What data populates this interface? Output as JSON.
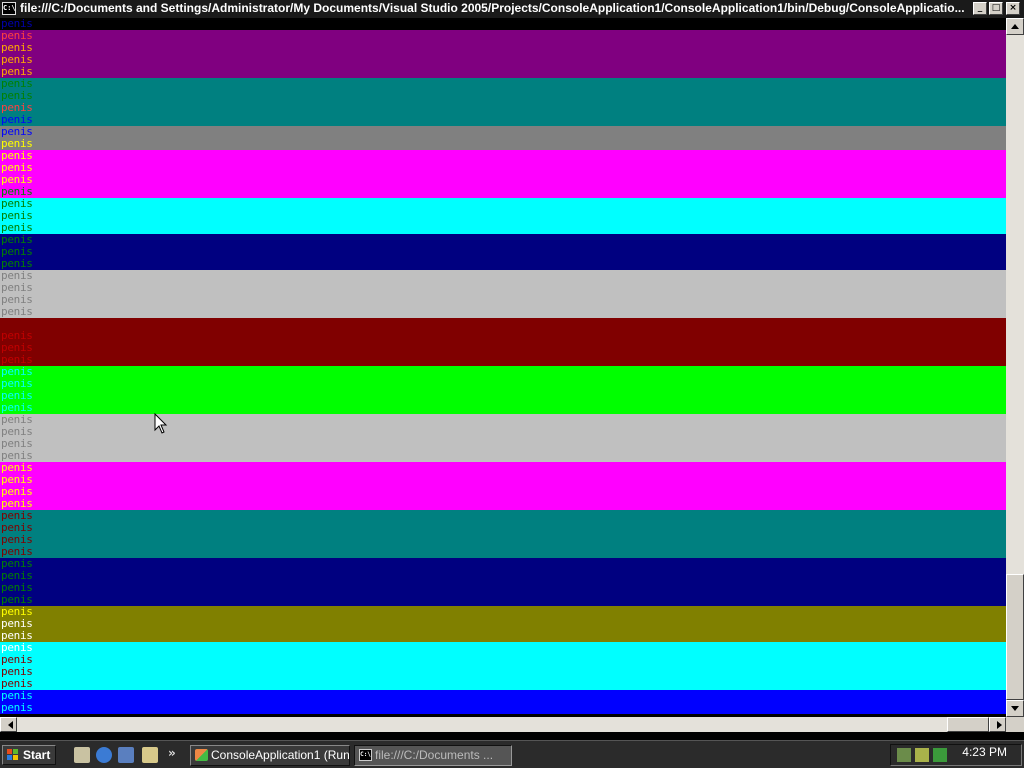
{
  "window": {
    "title": "file:///C:/Documents and Settings/Administrator/My Documents/Visual Studio 2005/Projects/ConsoleApplication1/ConsoleApplication1/bin/Debug/ConsoleApplicatio...",
    "buttons": {
      "minimize": "_",
      "maximize": "□",
      "close": "×"
    },
    "icon": "C:\\"
  },
  "console": {
    "word": "penis",
    "rows": [
      {
        "fg": "#0000aa",
        "bg": "#000000"
      },
      {
        "fg": "#ff4040",
        "bg": "#800080"
      },
      {
        "fg": "#ffaa00",
        "bg": "#800080"
      },
      {
        "fg": "#ffaa00",
        "bg": "#800080"
      },
      {
        "fg": "#ffaa00",
        "bg": "#800080"
      },
      {
        "fg": "#008000",
        "bg": "#008080"
      },
      {
        "fg": "#008000",
        "bg": "#008080"
      },
      {
        "fg": "#ff4040",
        "bg": "#008080"
      },
      {
        "fg": "#0000ff",
        "bg": "#008080"
      },
      {
        "fg": "#0000ff",
        "bg": "#808080"
      },
      {
        "fg": "#ffff00",
        "bg": "#808080"
      },
      {
        "fg": "#ffff00",
        "bg": "#ff00ff"
      },
      {
        "fg": "#ffff00",
        "bg": "#ff00ff"
      },
      {
        "fg": "#ffff00",
        "bg": "#ff00ff"
      },
      {
        "fg": "#008000",
        "bg": "#ff00ff"
      },
      {
        "fg": "#008000",
        "bg": "#00ffff"
      },
      {
        "fg": "#008000",
        "bg": "#00ffff"
      },
      {
        "fg": "#008000",
        "bg": "#00ffff"
      },
      {
        "fg": "#008000",
        "bg": "#000080"
      },
      {
        "fg": "#008000",
        "bg": "#000080"
      },
      {
        "fg": "#008000",
        "bg": "#000080"
      },
      {
        "fg": "#808080",
        "bg": "#c0c0c0"
      },
      {
        "fg": "#808080",
        "bg": "#c0c0c0"
      },
      {
        "fg": "#808080",
        "bg": "#c0c0c0"
      },
      {
        "fg": "#808080",
        "bg": "#c0c0c0"
      },
      {
        "fg": "#800000",
        "bg": "#800000"
      },
      {
        "fg": "#c00000",
        "bg": "#800000"
      },
      {
        "fg": "#c00000",
        "bg": "#800000"
      },
      {
        "fg": "#c00000",
        "bg": "#800000"
      },
      {
        "fg": "#00ffff",
        "bg": "#00ff00"
      },
      {
        "fg": "#00ffff",
        "bg": "#00ff00"
      },
      {
        "fg": "#00ffff",
        "bg": "#00ff00"
      },
      {
        "fg": "#00ffff",
        "bg": "#00ff00"
      },
      {
        "fg": "#808080",
        "bg": "#c0c0c0"
      },
      {
        "fg": "#808080",
        "bg": "#c0c0c0"
      },
      {
        "fg": "#808080",
        "bg": "#c0c0c0"
      },
      {
        "fg": "#808080",
        "bg": "#c0c0c0"
      },
      {
        "fg": "#ffff00",
        "bg": "#ff00ff"
      },
      {
        "fg": "#ffff00",
        "bg": "#ff00ff"
      },
      {
        "fg": "#ffff00",
        "bg": "#ff00ff"
      },
      {
        "fg": "#ffff00",
        "bg": "#ff00ff"
      },
      {
        "fg": "#800000",
        "bg": "#008080"
      },
      {
        "fg": "#800000",
        "bg": "#008080"
      },
      {
        "fg": "#800000",
        "bg": "#008080"
      },
      {
        "fg": "#800000",
        "bg": "#008080"
      },
      {
        "fg": "#008000",
        "bg": "#000080"
      },
      {
        "fg": "#008000",
        "bg": "#000080"
      },
      {
        "fg": "#008000",
        "bg": "#000080"
      },
      {
        "fg": "#008000",
        "bg": "#000080"
      },
      {
        "fg": "#ffff00",
        "bg": "#808000"
      },
      {
        "fg": "#ffffff",
        "bg": "#808000"
      },
      {
        "fg": "#ffffff",
        "bg": "#808000"
      },
      {
        "fg": "#ffffff",
        "bg": "#00ffff"
      },
      {
        "fg": "#800000",
        "bg": "#00ffff"
      },
      {
        "fg": "#800000",
        "bg": "#00ffff"
      },
      {
        "fg": "#800000",
        "bg": "#00ffff"
      },
      {
        "fg": "#00ffff",
        "bg": "#0000ff"
      },
      {
        "fg": "#00ffff",
        "bg": "#0000ff"
      }
    ]
  },
  "taskbar": {
    "start_label": "Start",
    "more_label": "»",
    "tasks": [
      {
        "label": "ConsoleApplication1 (Run...",
        "active": true
      },
      {
        "label": "file:///C:/Documents ...",
        "active": false
      }
    ],
    "clock": "4:23 PM"
  }
}
